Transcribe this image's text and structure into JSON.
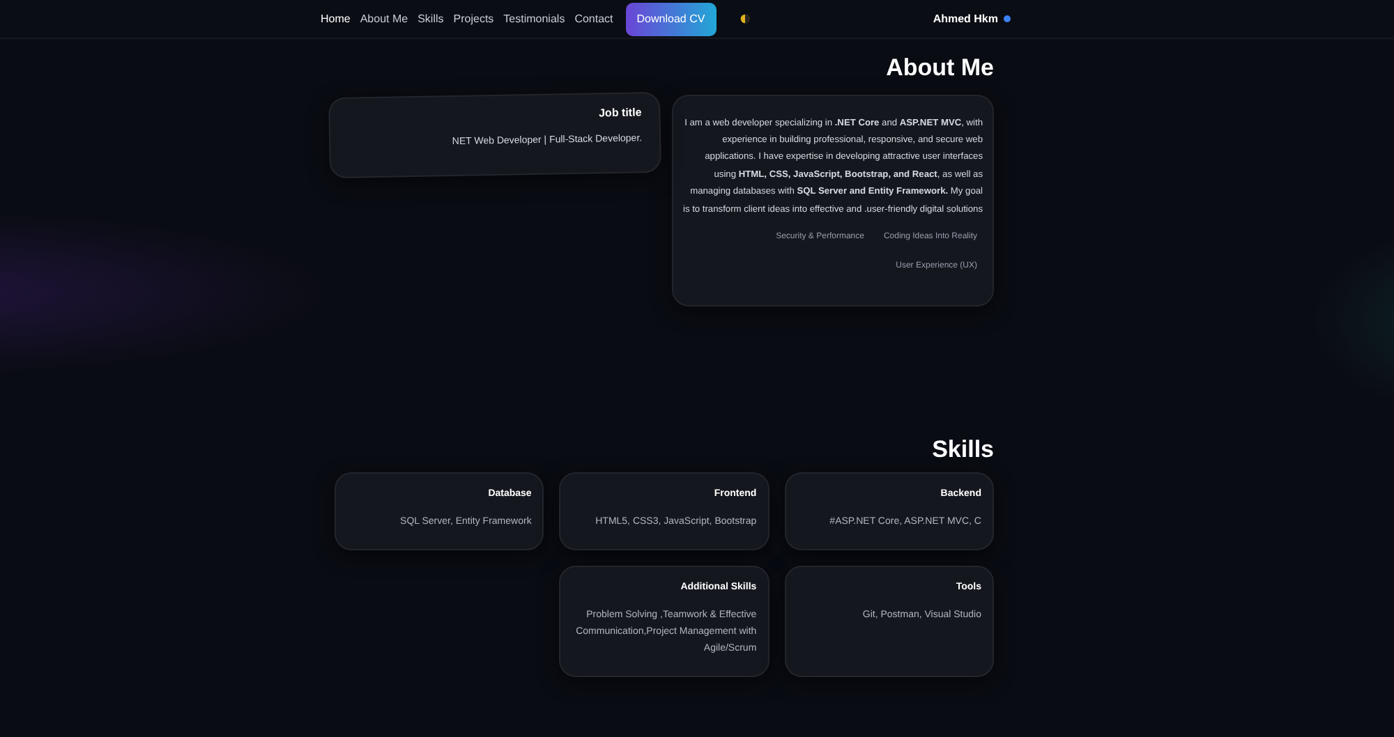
{
  "nav": {
    "links": [
      {
        "label": "Home",
        "selected": true
      },
      {
        "label": "About Me",
        "selected": false
      },
      {
        "label": "Skills",
        "selected": false
      },
      {
        "label": "Projects",
        "selected": false
      },
      {
        "label": "Testimonials",
        "selected": false
      },
      {
        "label": "Contact",
        "selected": false
      }
    ],
    "cta": "Download CV",
    "brand": "Ahmed Hkm"
  },
  "about": {
    "title": "About Me",
    "job": {
      "heading": "Job title",
      "text": "NET Web Developer | Full-Stack Developer."
    },
    "bio": "I am a web developer specializing in **.NET Core** and **ASP.NET MVC**, with experience in building professional, responsive, and secure web applications. I have expertise in developing attractive user interfaces using **HTML, CSS, JavaScript, Bootstrap, and React**, as well as managing databases with **SQL Server and Entity Framework.** My goal is to transform client ideas into effective and .user-friendly digital solutions",
    "tags": [
      "Security & Performance",
      "Coding Ideas Into Reality",
      "User Experience (UX)"
    ]
  },
  "skills": {
    "title": "Skills",
    "cards": [
      {
        "title": "Database",
        "text": "SQL Server, Entity Framework"
      },
      {
        "title": "Frontend",
        "text": "HTML5, CSS3, JavaScript, Bootstrap"
      },
      {
        "title": "Backend",
        "text": "#ASP.NET Core, ASP.NET MVC, C"
      },
      {
        "title": "Additional Skills",
        "text": "Problem Solving ,Teamwork & Effective Communication,Project Management with Agile/Scrum"
      },
      {
        "title": "Tools",
        "text": "Git, Postman, Visual Studio"
      }
    ]
  }
}
